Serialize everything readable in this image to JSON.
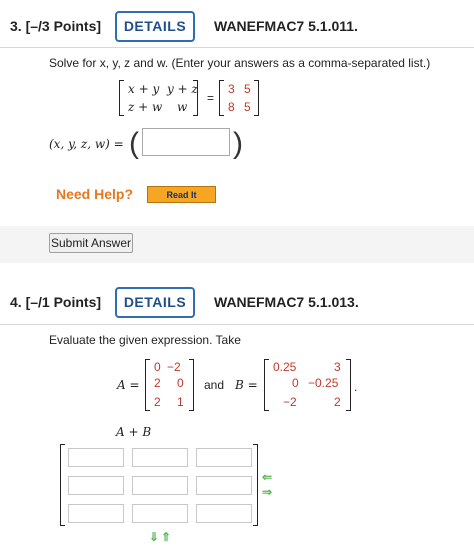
{
  "q3": {
    "number": "3.",
    "points": "[–/3 Points]",
    "details_label": "DETAILS",
    "id": "WANEFMAC7 5.1.011.",
    "prompt": "Solve for x, y, z and w. (Enter your answers as a comma-separated list.)",
    "matrix_left": [
      [
        "x + y",
        "y + z"
      ],
      [
        "z + w",
        "w"
      ]
    ],
    "matrix_right": [
      [
        "3",
        "5"
      ],
      [
        "8",
        "5"
      ]
    ],
    "equals": "=",
    "answer_label": "(x, y, z, w) =",
    "answer_value": "",
    "need_help": "Need Help?",
    "read_it": "Read It",
    "submit": "Submit Answer"
  },
  "q4": {
    "number": "4.",
    "points": "[–/1 Points]",
    "details_label": "DETAILS",
    "id": "WANEFMAC7 5.1.013.",
    "prompt": "Evaluate the given expression. Take",
    "A_label": "A =",
    "A": [
      [
        "0",
        "−2"
      ],
      [
        "2",
        "0"
      ],
      [
        "2",
        "1"
      ]
    ],
    "and": "and",
    "B_label": "B =",
    "B": [
      [
        "0.25",
        "3"
      ],
      [
        "0",
        "−0.25"
      ],
      [
        "−2",
        "2"
      ]
    ],
    "period": ".",
    "expr": "A + B"
  },
  "colors": {
    "accent": "#2f6db5",
    "matrix_entry": "#c0392b",
    "need_help": "#e87722",
    "read_it_bg": "#f6a623",
    "arrow": "#5cb85c"
  }
}
